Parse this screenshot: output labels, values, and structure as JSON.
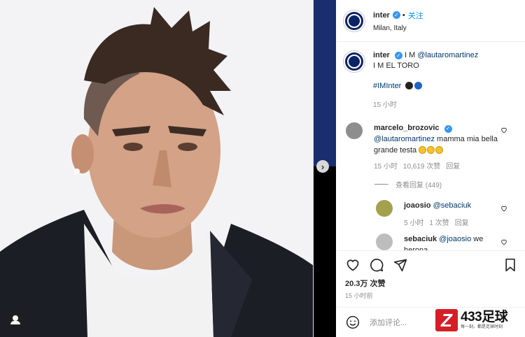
{
  "post": {
    "username": "inter",
    "follow_label": "关注",
    "location": "Milan, Italy",
    "caption_user": "inter",
    "caption_line1_prefix": "I M ",
    "caption_mention": "@lautaromartinez",
    "caption_line2": "I M EL TORO",
    "caption_hashtag": "#IMInter",
    "caption_time": "15 小时",
    "likes": "20.3万 次赞",
    "post_time": "15 小时前",
    "add_comment_placeholder": "添加评论..."
  },
  "comments": [
    {
      "user": "marcelo_brozovic",
      "mention": "@lautaromartinez",
      "text": " mamma mia bella grande testa",
      "time": "15 小时",
      "likes": "10,619 次赞",
      "reply": "回复",
      "view_replies": "查看回复 (449)"
    },
    {
      "user": "joaosio",
      "mention": "@sebaciuk",
      "text": "",
      "time": "5 小时",
      "likes": "1 次赞",
      "reply": "回复"
    },
    {
      "user": "sebaciuk",
      "mention": "@joaosio",
      "text": " we",
      "text_cut": "herona"
    }
  ],
  "watermark": {
    "brand": "433足球",
    "tagline": "每一刻，都是足球时刻"
  },
  "colors": {
    "link": "#00376b",
    "follow": "#0095f6",
    "verified": "#3897f0",
    "inter_blue": "#0a2466",
    "brand_red": "#d41f26"
  }
}
